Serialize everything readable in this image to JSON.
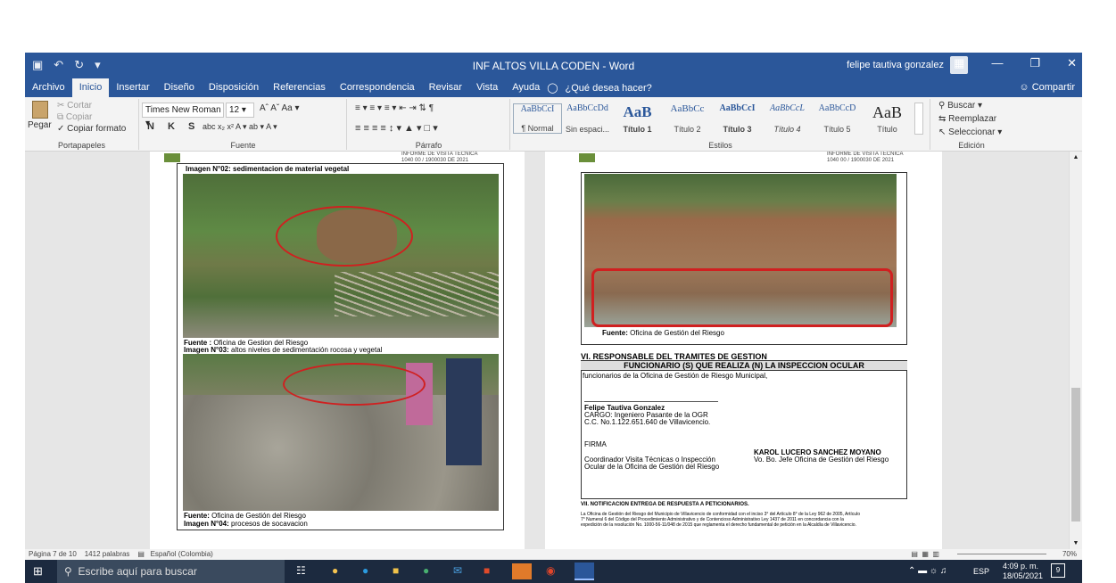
{
  "window": {
    "title": "INF ALTOS VILLA CODEN  -  Word",
    "user": "felipe tautiva gonzalez"
  },
  "tabs": [
    "Archivo",
    "Inicio",
    "Insertar",
    "Diseño",
    "Disposición",
    "Referencias",
    "Correspondencia",
    "Revisar",
    "Vista",
    "Ayuda"
  ],
  "tell_me": "¿Qué desea hacer?",
  "share": "Compartir",
  "clipboard": {
    "paste": "Pegar",
    "cut": "Cortar",
    "copy": "Copiar",
    "format": "Copiar formato",
    "label": "Portapapeles"
  },
  "font": {
    "name": "Times New Roman",
    "size": "12",
    "label": "Fuente"
  },
  "paragraph_label": "Párrafo",
  "styles": {
    "label": "Estilos",
    "items": [
      {
        "preview": "AaBbCcI",
        "name": "¶ Normal"
      },
      {
        "preview": "AaBbCcDd",
        "name": "Sin espaci..."
      },
      {
        "preview": "AaB",
        "name": "Título 1"
      },
      {
        "preview": "AaBbCc",
        "name": "Título 2"
      },
      {
        "preview": "AaBbCcI",
        "name": "Título 3"
      },
      {
        "preview": "AaBbCcL",
        "name": "Título 4"
      },
      {
        "preview": "AaBbCcD",
        "name": "Título 5"
      },
      {
        "preview": "AaB",
        "name": "Título"
      }
    ]
  },
  "editing": {
    "find": "Buscar",
    "replace": "Reemplazar",
    "select": "Seleccionar",
    "label": "Edición"
  },
  "left_page": {
    "header": "INFORME DE VISITA TÉCNICA",
    "header2": "1040 00 / 1900030  DE 2021",
    "logo": "Municipio de Villavicencio",
    "cap1": "Imagen N°02: sedimentacion de material vegetal",
    "src1_label": "Fuente :",
    "src1": " Oficina de Gestion del Riesgo",
    "cap2_label": "Imagen N°03:",
    "cap2": " altos niveles de sedimentación rocosa y vegetal",
    "src2_label": "Fuente:",
    "src2": " Oficina de Gestión del Riesgo",
    "cap3_label": "Imagen N°04:",
    "cap3": " procesos de socavacion"
  },
  "right_page": {
    "header": "INFORME DE VISITA TÉCNICA",
    "header2": "1040 00 / 1900030  DE 2021",
    "src_label": "Fuente:",
    "src": " Oficina de Gestión del Riesgo",
    "section": "VI.     RESPONSABLE DEL TRAMITES DE GESTION",
    "table_head": "FUNCIONARIO (S) QUE REALIZA (N) LA INSPECCION OCULAR",
    "table_intro": "funcionarios de la Oficina de Gestión de Riesgo Municipal,",
    "name": "Felipe Tautiva Gonzalez",
    "cargo": "CARGO: Ingeniero Pasante de la OGR",
    "cc": "C.C. No.1.122.651.640 de Villavicencio.",
    "firma": "FIRMA",
    "coord1": "Coordinador Visita Técnicas o Inspección",
    "coord2": " Ocular de la Oficina de Gestión del Riesgo",
    "jefe_name": "KAROL LUCERO SANCHEZ MOYANO",
    "jefe_role": "Vo. Bo. Jefe Oficina de Gestión del Riesgo",
    "vii": "VII.      NOTIFICACION ENTREGA DE RESPUESTA A PETICIONARIOS.",
    "para1": "La Oficina de Gestión del Riesgo del Municipio de Villavicencio de conformidad con el inciso 3° del Artículo 8° de la Ley 962 de 2005, Artículo",
    "para2": "7° Numeral 6 del Código del Procedimiento Administrativo y de Contencioso Administrativo Ley 1437 de 2011 en concordancia con la",
    "para3": "expedición de la resolución No. 1000-56-11/048 de 2015 que reglamenta el derecho fundamental de petición en la Alcaldía de Villavicencio."
  },
  "status": {
    "page": "Página 7 de 10",
    "words": "1412 palabras",
    "lang": "Español (Colombia)",
    "zoom": "70%"
  },
  "taskbar": {
    "search": "Escribe aquí para buscar",
    "lang": "ESP",
    "time": "4:09 p. m.",
    "date": "18/05/2021",
    "badge": "9"
  }
}
